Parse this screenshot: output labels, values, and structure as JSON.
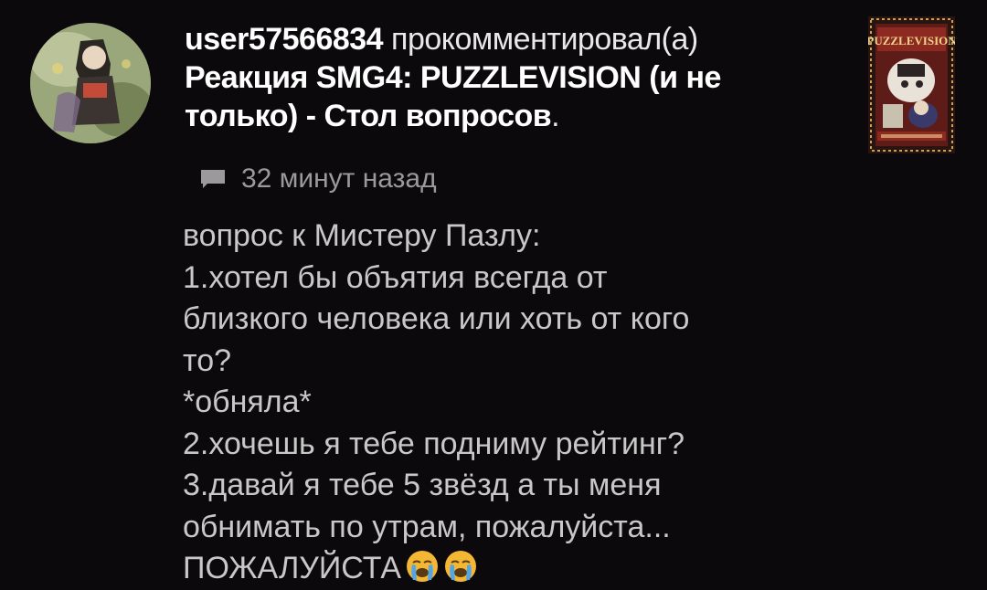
{
  "notification": {
    "username": "user57566834",
    "action": " прокомментировал(а) ",
    "video_title": "Реакция SMG4: PUZZLEVISION (и не только) - Стол вопросов",
    "title_end": ".",
    "time_ago": "32 минут назад",
    "comment_lines": [
      "вопрос к Мистеру Пазлу:",
      "1.хотел бы объятия всегда от",
      "близкого человека или хоть от кого",
      "то?",
      "*обняла*",
      "2.хочешь я тебе подниму рейтинг?",
      "3.давай я тебе 5 звёзд а ты меня",
      "обнимать по утрам, пожалуйста...",
      "ПОЖАЛУЙСТА"
    ],
    "thumbnail_text": "PUZZLEVISION",
    "icons": {
      "comment": "comment-icon",
      "emoji": "loudly-crying-face-emoji"
    },
    "colors": {
      "background": "#0b090b",
      "primary_text": "#ffffff",
      "secondary_text": "#9a9a9a",
      "comment_text": "#c8c8c8"
    }
  }
}
